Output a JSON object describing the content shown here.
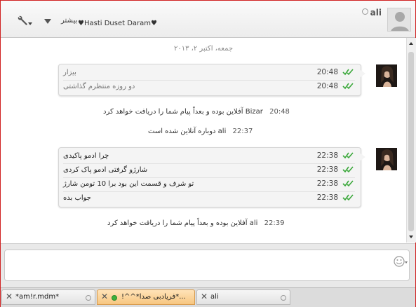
{
  "header": {
    "contact_name": "ali",
    "status_message": "♥Hasti Duset Daram♥",
    "more_label": "بیشتر",
    "settings_icon": "wrench-icon",
    "dropdown_icon": "triangle-down-icon",
    "avatar_icon": "default-user-icon"
  },
  "chat": {
    "date_header": "جمعه، اکتبر ۲، ۲۰۱۳",
    "groups": [
      {
        "messages": [
          {
            "text": "بیزار",
            "time": "20:48"
          },
          {
            "text": "دو روزه منتظرم گذاشتی",
            "time": "20:48"
          }
        ]
      },
      {
        "messages": [
          {
            "text": "چرا ادمو پاکیدی",
            "time": "22:38"
          },
          {
            "text": "شارژو گرفتی ادمو پاک کردی",
            "time": "22:38"
          },
          {
            "text": "تو شرف و قسمت این بود برا 10 تومن شارژ",
            "time": "22:38"
          },
          {
            "text": "جواب بده",
            "time": "22:38"
          }
        ]
      }
    ],
    "system_lines": [
      {
        "time": "20:48",
        "text": "Bizar آفلاین بوده و بعداً پیام شما را دریافت خواهد کرد"
      },
      {
        "time": "22:37",
        "text": "ali دوباره آنلاین شده است"
      },
      {
        "time": "22:39",
        "text": "ali آفلاین بوده و بعداً پیام شما را دریافت خواهد کرد"
      }
    ]
  },
  "composer": {
    "emoticon_icon": "smiley-icon"
  },
  "tabs": [
    {
      "label": "*am!r.mdm*",
      "status": "offline"
    },
    {
      "label": "!^^*فریادبی صدا*...",
      "status": "online"
    },
    {
      "label": "ali",
      "status": "offline"
    }
  ],
  "colors": {
    "checkmark": "#3aa83a",
    "active_tab": "#f7c680",
    "frame_border": "#d02020"
  }
}
